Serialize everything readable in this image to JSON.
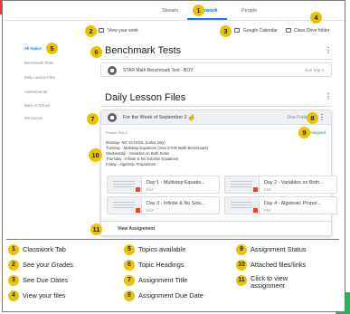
{
  "tabs": {
    "stream": "Stream",
    "classwork": "Classwork",
    "people": "People"
  },
  "toolbar": {
    "view_work": "View your work",
    "calendar": "Google Calendar",
    "drive": "Class Drive folder"
  },
  "sidebar": {
    "items": [
      {
        "label": "All topics"
      },
      {
        "label": "Benchmark Tests"
      },
      {
        "label": "Daily Lesson Files"
      },
      {
        "label": "Assessments"
      },
      {
        "label": "Back to School"
      },
      {
        "label": "Resources"
      }
    ]
  },
  "benchmark": {
    "heading": "Benchmark Tests",
    "item_title": "STAR Math Benchmark Test - BOY",
    "item_due": "Due Sep 3"
  },
  "daily": {
    "heading": "Daily Lesson Files",
    "assignment_title": "For the Week of September 2 - 6",
    "due": "Due Friday",
    "posted": "Posted Sep 2",
    "status": "Assigned",
    "schedule": [
      "Monday- NO SCHOOL (Labor Day)",
      "Tuesday - Multistep Equations (Also STAR Math Benchmark)",
      "Wednesday - Variables on Both Sides",
      "Thursday - Infinite & No Solution Equations",
      "Friday - Algebraic Proportions"
    ],
    "files": [
      {
        "title": "Day 1 - Multistep Equatio...",
        "type": "PDF"
      },
      {
        "title": "Day 2 - Variables on Both...",
        "type": "PDF"
      },
      {
        "title": "Day 3 - Infinite & No Solu...",
        "type": "PDF"
      },
      {
        "title": "Day 4 - Algebraic Propor...",
        "type": "PDF"
      }
    ],
    "view_assignment": "View Assignment"
  },
  "markers": {
    "m1": "1",
    "m2": "2",
    "m3": "3",
    "m4": "4",
    "m5": "5",
    "m6": "6",
    "m7": "7",
    "m8": "8",
    "m9": "9",
    "m10": "10",
    "m11": "11"
  },
  "legend": [
    {
      "num": "1",
      "text": "Classwork Tab"
    },
    {
      "num": "2",
      "text": "See your Grades"
    },
    {
      "num": "3",
      "text": "See Due Dates"
    },
    {
      "num": "4",
      "text": "View your files"
    },
    {
      "num": "5",
      "text": "Topics available"
    },
    {
      "num": "6",
      "text": "Topic Headings"
    },
    {
      "num": "7",
      "text": "Assignment Title"
    },
    {
      "num": "8",
      "text": "Assignment Due Date"
    },
    {
      "num": "9",
      "text": "Assignment Status"
    },
    {
      "num": "10",
      "text": "Attached files/links"
    },
    {
      "num": "11",
      "text": "Click to view assignment"
    }
  ],
  "colors": {
    "accent": "#1a73e8",
    "marker": "#e8c400",
    "corner_red": "#e53935",
    "corner_green": "#1db954"
  }
}
